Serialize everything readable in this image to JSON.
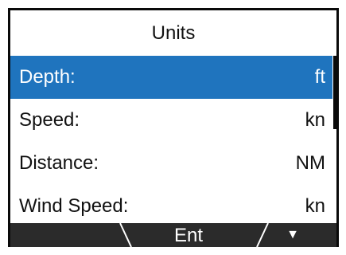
{
  "screen": {
    "title": "Units"
  },
  "rows": [
    {
      "label": "Depth:",
      "value": "ft",
      "selected": true
    },
    {
      "label": "Speed:",
      "value": "kn",
      "selected": false
    },
    {
      "label": "Distance:",
      "value": "NM",
      "selected": false
    },
    {
      "label": "Wind Speed:",
      "value": "kn",
      "selected": false
    }
  ],
  "softkeys": {
    "left": "",
    "center": "Ent",
    "right_icon": "down-triangle-icon",
    "right_glyph": "▼"
  },
  "colors": {
    "selection": "#1f74be",
    "softkey_bar": "#2b2b2b",
    "frame": "#0a0a0a"
  }
}
